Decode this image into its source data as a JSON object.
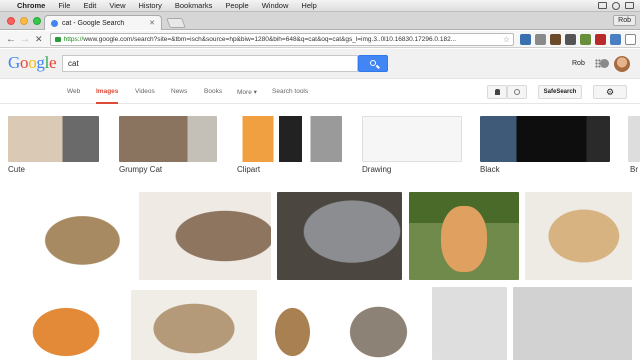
{
  "menubar": {
    "app": "Chrome",
    "items": [
      "File",
      "Edit",
      "View",
      "History",
      "Bookmarks",
      "People",
      "Window",
      "Help"
    ]
  },
  "browser": {
    "tab_title": "cat - Google Search",
    "profile": "Rob",
    "url_protocol": "https://",
    "url_rest": "www.google.com/search?site=&tbm=isch&source=hp&biw=1280&bih=648&q=cat&oq=cat&gs_l=img.3..0l10.16830.17296.0.182..."
  },
  "google": {
    "logo_letters": [
      "G",
      "o",
      "o",
      "g",
      "l",
      "e"
    ],
    "logo_colors": [
      "#4285f4",
      "#ea4335",
      "#fbbc05",
      "#4285f4",
      "#34a853",
      "#ea4335"
    ],
    "query": "cat",
    "user": "Rob",
    "tabs": [
      "Web",
      "Images",
      "Videos",
      "News",
      "Books",
      "More ▾",
      "Search tools"
    ],
    "safesearch": "SafeSearch"
  },
  "related": [
    {
      "label": "Cute"
    },
    {
      "label": "Grumpy Cat"
    },
    {
      "label": "Clipart"
    },
    {
      "label": "Drawing"
    },
    {
      "label": "Black"
    },
    {
      "label": "Br"
    }
  ],
  "colors": {
    "accent_red": "#dd4b39",
    "search_blue": "#4285f4"
  }
}
